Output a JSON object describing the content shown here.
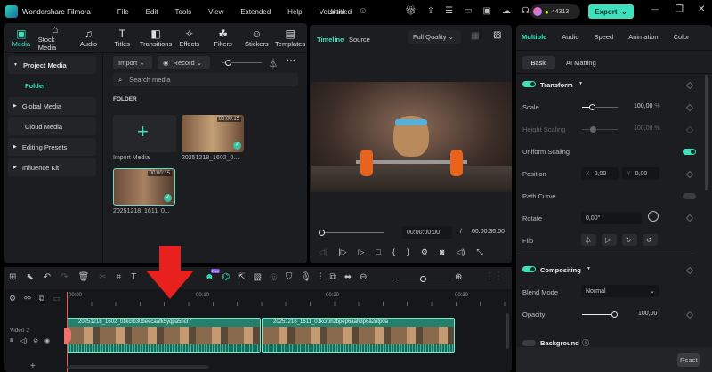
{
  "titlebar": {
    "app_name": "Wondershare Filmora",
    "menu": [
      "File",
      "Edit",
      "Tools",
      "View",
      "Extended",
      "Help",
      "Version"
    ],
    "project": "Untitled",
    "credits": "44313",
    "export_label": "Export"
  },
  "tabs": [
    {
      "label": "Media",
      "icon": "media-icon"
    },
    {
      "label": "Stock Media",
      "icon": "stock-icon"
    },
    {
      "label": "Audio",
      "icon": "music-icon"
    },
    {
      "label": "Titles",
      "icon": "title-icon"
    },
    {
      "label": "Transitions",
      "icon": "transition-icon"
    },
    {
      "label": "Effects",
      "icon": "effects-icon"
    },
    {
      "label": "Filters",
      "icon": "filters-icon"
    },
    {
      "label": "Stickers",
      "icon": "sticker-icon"
    },
    {
      "label": "Templates",
      "icon": "template-icon"
    }
  ],
  "sidebar": {
    "items": [
      "Project Media",
      "Folder",
      "Global Media",
      "Cloud Media",
      "Editing Presets",
      "Influence Kit"
    ]
  },
  "media": {
    "import_label": "Import",
    "record_label": "Record",
    "search_placeholder": "Search media",
    "folder_heading": "FOLDER",
    "import_media": "Import Media",
    "items": [
      {
        "name": "20251218_1602_0...",
        "duration": "00:00:15"
      },
      {
        "name": "20251218_1611_0...",
        "duration": "00:00:15"
      }
    ]
  },
  "preview": {
    "tab_timeline": "Timeline",
    "tab_source": "Source",
    "quality": "Full Quality",
    "current_time": "00:00:00:00",
    "separator": "/",
    "total_time": "00:00:30:00"
  },
  "props": {
    "tabs": [
      "Multiple",
      "Audio",
      "Speed",
      "Animation",
      "Color"
    ],
    "subtabs": [
      "Basic",
      "AI Matting"
    ],
    "transform": "Transform",
    "scale_label": "Scale",
    "scale_value": "100,00",
    "height_label": "Height Scaling",
    "height_value": "100,00",
    "pct": "%",
    "uniform_label": "Uniform Scaling",
    "position_label": "Position",
    "x_label": "X",
    "x_value": "0,00",
    "y_label": "Y",
    "y_value": "0,00",
    "path_label": "Path Curve",
    "rotate_label": "Rotate",
    "rotate_value": "0,00°",
    "flip_label": "Flip",
    "compositing": "Compositing",
    "blend_label": "Blend Mode",
    "blend_value": "Normal",
    "opacity_label": "Opacity",
    "opacity_value": "100,00",
    "background": "Background",
    "reset": "Reset"
  },
  "timeline": {
    "ruler": [
      "00:00",
      "00:10",
      "00:20",
      "00:30"
    ],
    "track_name": "Video 2",
    "clips": [
      "20251218_1602_01kcrb30beecaafk5yqpa5hcr7",
      "20251218_1611_01kcrbhzbpep6aah3p6a2ntp0a"
    ],
    "badge": "Free"
  }
}
